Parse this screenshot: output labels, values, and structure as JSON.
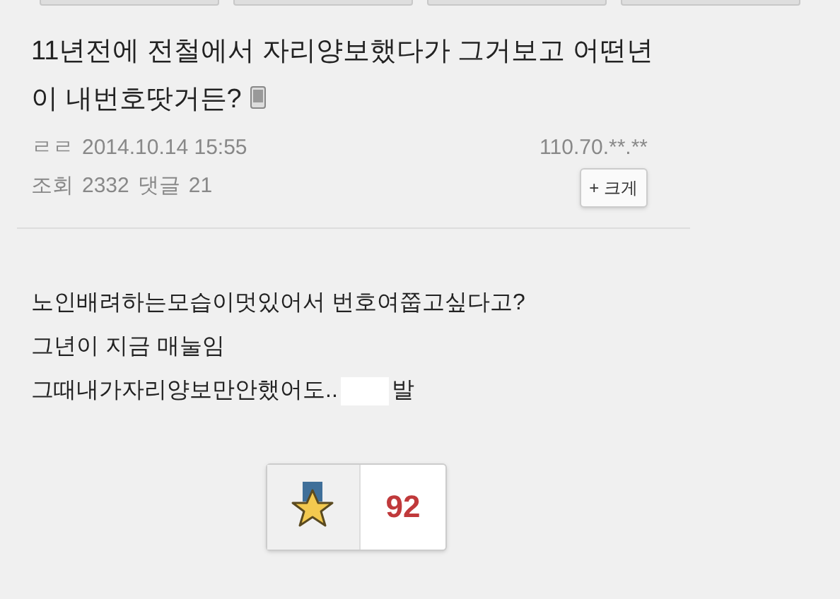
{
  "top_tabs": [
    {
      "kind": "tab"
    },
    {
      "kind": "tab"
    },
    {
      "kind": "tab"
    },
    {
      "kind": "tab"
    }
  ],
  "post": {
    "title": "11년전에 전철에서 자리양보했다가 그거보고 어떤년이 내번호땃거든?",
    "mobile": true,
    "author": "ㄹㄹ",
    "date": "2014.10.14 15:55",
    "ip": "110.70.**.**",
    "views_label": "조회",
    "views": "2332",
    "comments_label": "댓글",
    "comments": "21",
    "zoom_button": "+ 크게"
  },
  "body": [
    {
      "text": "노인배려하는모습이멋있어서 번호여쭙고싶다고?"
    },
    {
      "text": "그년이 지금 매눌임"
    },
    {
      "text": "그때내가자리양보만안했어도..",
      "censored": true,
      "after": "발"
    }
  ],
  "recommend": {
    "count": "92"
  }
}
